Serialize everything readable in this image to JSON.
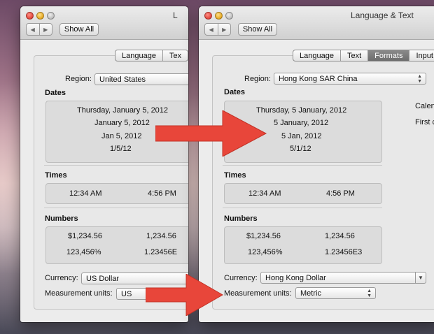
{
  "left_window": {
    "title_partial": "L",
    "show_all": "Show All",
    "tabs": [
      "Language",
      "Tex"
    ],
    "region_label": "Region:",
    "region_value": "United States",
    "dates_heading": "Dates",
    "dates": [
      "Thursday, January 5, 2012",
      "January 5, 2012",
      "Jan 5, 2012",
      "1/5/12"
    ],
    "times_heading": "Times",
    "times": [
      "12:34 AM",
      "4:56 PM"
    ],
    "numbers_heading": "Numbers",
    "numbers": [
      "$1,234.56",
      "1,234.56",
      "123,456%",
      "1.23456E"
    ],
    "currency_label": "Currency:",
    "currency_value": "US Dollar",
    "measurement_label": "Measurement units:",
    "measurement_value": "US"
  },
  "right_window": {
    "title": "Language & Text",
    "show_all": "Show All",
    "tabs": [
      "Language",
      "Text",
      "Formats",
      "Input S"
    ],
    "active_tab": "Formats",
    "region_label": "Region:",
    "region_value": "Hong Kong SAR China",
    "dates_heading": "Dates",
    "dates": [
      "Thursday, 5 January, 2012",
      "5 January, 2012",
      "5 Jan, 2012",
      "5/1/12"
    ],
    "calendar_partial": "Calen",
    "first_partial": "First c",
    "times_heading": "Times",
    "times": [
      "12:34 AM",
      "4:56 PM"
    ],
    "numbers_heading": "Numbers",
    "numbers": [
      "$1,234.56",
      "1,234.56",
      "123,456%",
      "1.23456E3"
    ],
    "currency_label": "Currency:",
    "currency_value": "Hong Kong Dollar",
    "measurement_label": "Measurement units:",
    "measurement_value": "Metric"
  },
  "colors": {
    "arrow": "#e8463a",
    "active_tab": "#777777",
    "close": "#e2443a",
    "minimize": "#e5a720"
  },
  "icons": {
    "back": "chevron-left-icon",
    "forward": "chevron-right-icon",
    "popup": "updown-arrows-icon"
  }
}
